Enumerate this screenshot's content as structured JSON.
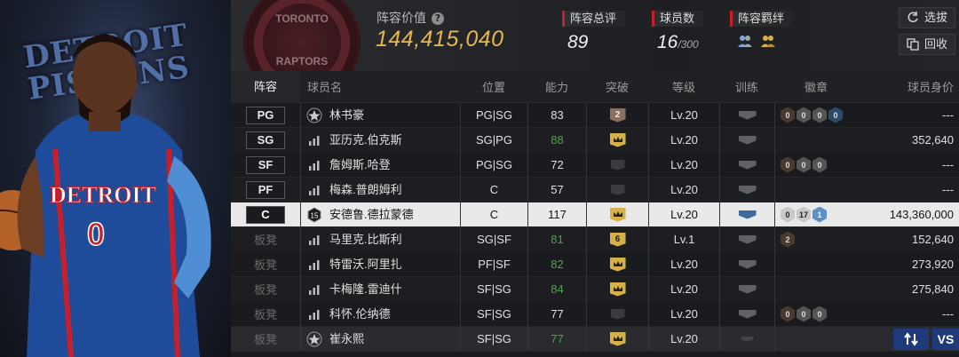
{
  "hero": {
    "tag": "DETROIT PISTONS",
    "jersey_text": "DETROIT",
    "jersey_number": "0"
  },
  "logo": {
    "top_text": "TORONTO",
    "bottom_text": "RAPTORS"
  },
  "header": {
    "lineup_value_label": "阵容价值",
    "lineup_value": "144,415,040",
    "total_rating_label": "阵容总评",
    "total_rating": "89",
    "player_count_label": "球员数",
    "player_count": "16",
    "player_count_max": "/300",
    "bond_label": "阵容羁绊",
    "select_button": "选拔",
    "recycle_button": "回收"
  },
  "columns": [
    "阵容",
    "球员名",
    "位置",
    "能力",
    "突破",
    "等级",
    "训练",
    "徽章",
    "球员身价"
  ],
  "rows": [
    {
      "slot": "PG",
      "bench": false,
      "rank": "star",
      "name": "林书豪",
      "pos": "PG|SG",
      "ability": "83",
      "ability_green": false,
      "break": "2",
      "break_type": "num-bronze",
      "level": "Lv.20",
      "training": true,
      "badges": [
        "0",
        "0",
        "0",
        "0"
      ],
      "value": "---"
    },
    {
      "slot": "SG",
      "bench": false,
      "rank": "bars",
      "name": "亚历克.伯克斯",
      "pos": "SG|PG",
      "ability": "88",
      "ability_green": true,
      "break": "",
      "break_type": "crown",
      "level": "Lv.20",
      "training": true,
      "badges": [],
      "value": "352,640"
    },
    {
      "slot": "SF",
      "bench": false,
      "rank": "bars",
      "name": "詹姆斯.哈登",
      "pos": "PG|SG",
      "ability": "72",
      "ability_green": false,
      "break": "",
      "break_type": "empty",
      "level": "Lv.20",
      "training": true,
      "badges": [
        "0",
        "0",
        "0"
      ],
      "value": "---"
    },
    {
      "slot": "PF",
      "bench": false,
      "rank": "bars",
      "name": "梅森.普朗姆利",
      "pos": "C",
      "ability": "57",
      "ability_green": false,
      "break": "",
      "break_type": "empty",
      "level": "Lv.20",
      "training": true,
      "badges": [],
      "value": "---"
    },
    {
      "slot": "C",
      "bench": false,
      "selected": true,
      "rank": "15",
      "name": "安德鲁.德拉蒙德",
      "pos": "C",
      "ability": "117",
      "ability_green": false,
      "break": "",
      "break_type": "crown",
      "level": "Lv.20",
      "training": true,
      "badges": [
        "0",
        "17",
        "1"
      ],
      "value": "143,360,000"
    },
    {
      "slot": "板凳",
      "bench": true,
      "rank": "bars",
      "name": "马里克.比斯利",
      "pos": "SG|SF",
      "ability": "81",
      "ability_green": true,
      "break": "6",
      "break_type": "num",
      "level": "Lv.1",
      "training": true,
      "badges": [
        "2"
      ],
      "value": "152,640"
    },
    {
      "slot": "板凳",
      "bench": true,
      "rank": "bars",
      "name": "特雷沃.阿里扎",
      "pos": "PF|SF",
      "ability": "82",
      "ability_green": true,
      "break": "",
      "break_type": "crown",
      "level": "Lv.20",
      "training": true,
      "badges": [],
      "value": "273,920"
    },
    {
      "slot": "板凳",
      "bench": true,
      "rank": "bars",
      "name": "卡梅隆.雷迪什",
      "pos": "SF|SG",
      "ability": "84",
      "ability_green": true,
      "break": "",
      "break_type": "crown",
      "level": "Lv.20",
      "training": true,
      "badges": [],
      "value": "275,840"
    },
    {
      "slot": "板凳",
      "bench": true,
      "rank": "bars",
      "name": "科怀.伦纳德",
      "pos": "SF|SG",
      "ability": "77",
      "ability_green": false,
      "break": "",
      "break_type": "empty",
      "level": "Lv.20",
      "training": true,
      "badges": [
        "0",
        "0",
        "0"
      ],
      "value": "---"
    },
    {
      "slot": "板凳",
      "bench": true,
      "dim": true,
      "rank": "star",
      "name": "崔永熙",
      "pos": "SF|SG",
      "ability": "77",
      "ability_green": true,
      "break": "",
      "break_type": "crown",
      "level": "Lv.20",
      "training": false,
      "badges": [],
      "value": ""
    }
  ],
  "last_row_actions": {
    "swap_icon": "swap-arrows-icon",
    "vs_label": "VS"
  }
}
